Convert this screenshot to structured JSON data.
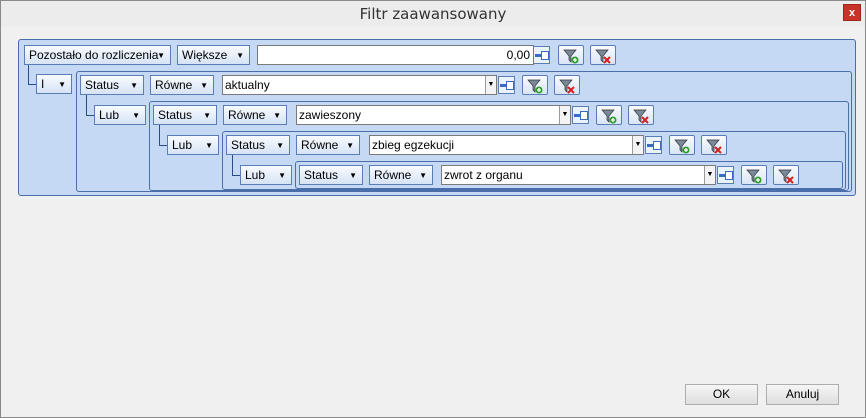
{
  "window": {
    "title": "Filtr zaawansowany",
    "close_label": "x"
  },
  "root": {
    "field": "Pozostało do rozliczenia",
    "operator": "Większe",
    "value": "0,00",
    "join": "I"
  },
  "level1": {
    "field": "Status",
    "operator": "Równe",
    "value": "aktualny",
    "join": "Lub"
  },
  "level2": {
    "field": "Status",
    "operator": "Równe",
    "value": "zawieszony",
    "join": "Lub"
  },
  "level3": {
    "field": "Status",
    "operator": "Równe",
    "value": "zbieg egzekucji",
    "join": "Lub"
  },
  "level4": {
    "field": "Status",
    "operator": "Równe",
    "value": "zwrot z organu"
  },
  "footer": {
    "ok_label": "OK",
    "cancel_label": "Anuluj"
  },
  "colors": {
    "panel": "#c6d9f4",
    "border": "#4a6ea9",
    "close": "#c7342a"
  }
}
